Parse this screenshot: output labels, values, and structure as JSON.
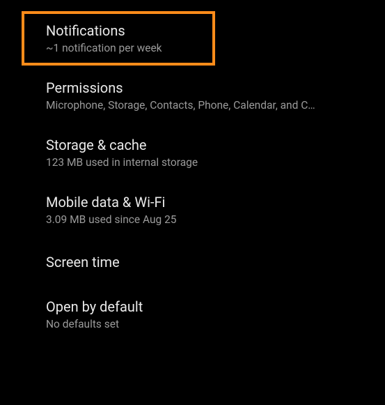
{
  "items": [
    {
      "title": "Notifications",
      "subtitle": "~1 notification per week"
    },
    {
      "title": "Permissions",
      "subtitle": "Microphone, Storage, Contacts, Phone, Calendar, and C…"
    },
    {
      "title": "Storage & cache",
      "subtitle": "123 MB used in internal storage"
    },
    {
      "title": "Mobile data & Wi-Fi",
      "subtitle": "3.09 MB used since Aug 25"
    },
    {
      "title": "Screen time",
      "subtitle": null
    },
    {
      "title": "Open by default",
      "subtitle": "No defaults set"
    }
  ],
  "highlight": {
    "color": "#ff8c1a"
  }
}
